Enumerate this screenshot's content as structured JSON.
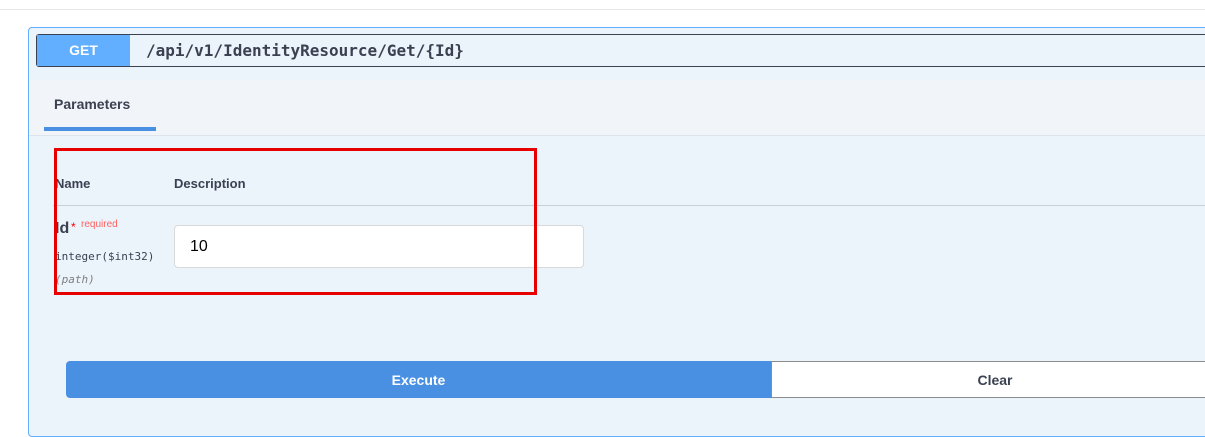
{
  "endpoint": {
    "method": "GET",
    "path": "/api/v1/IdentityResource/Get/{Id}"
  },
  "tabs": {
    "parameters_label": "Parameters"
  },
  "table": {
    "headers": {
      "name": "Name",
      "description": "Description"
    },
    "parameter": {
      "name": "Id",
      "required_star": "*",
      "required_label": "required",
      "type": "integer($int32)",
      "location": "(path)",
      "value": "10"
    }
  },
  "actions": {
    "execute_label": "Execute",
    "clear_label": "Clear"
  },
  "colors": {
    "method_bg": "#61affe",
    "execute_bg": "#4990e2",
    "highlight_border": "#e60000",
    "required": "#ff0000"
  }
}
